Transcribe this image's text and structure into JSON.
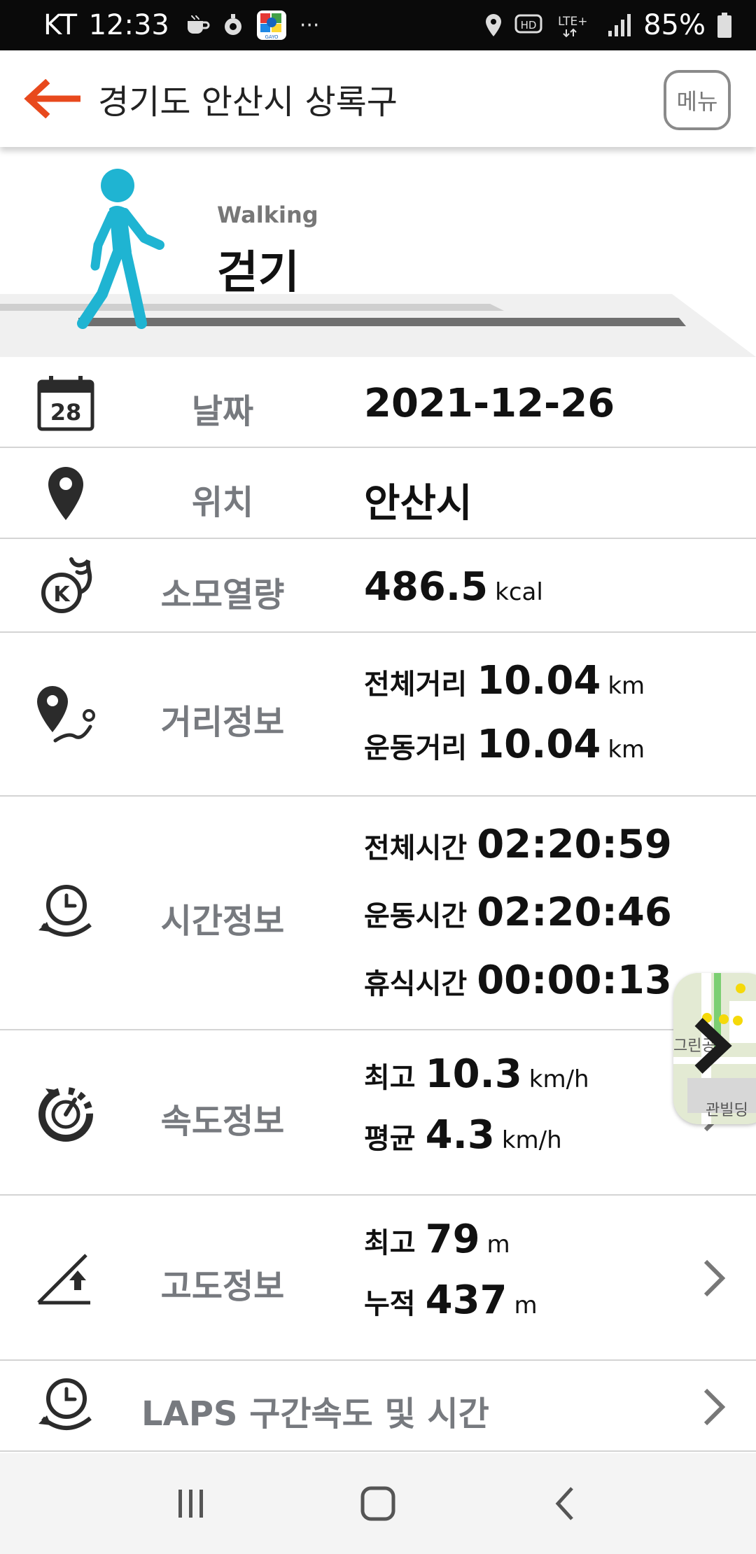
{
  "status_bar": {
    "carrier": "KT",
    "time": "12:33",
    "notification_icons": [
      "coffee-icon",
      "location-pin-icon",
      "gayo-app-icon",
      "more-icon"
    ],
    "lte_label": "LTE+",
    "hd_label": "HD",
    "battery_percent": "85%"
  },
  "header": {
    "title": "경기도 안산시 상록구",
    "menu_label": "메뉴",
    "accent_color": "#e8491d"
  },
  "activity": {
    "name_en": "Walking",
    "name_ko": "걷기",
    "figure_color": "#1fb4d2"
  },
  "rows": {
    "date": {
      "label": "날짜",
      "value": "2021-12-26",
      "calendar_day": "28"
    },
    "location": {
      "label": "위치",
      "value": "안산시"
    },
    "calories": {
      "label": "소모열량",
      "value": "486.5",
      "unit": "kcal"
    },
    "distance": {
      "label": "거리정보",
      "lines": [
        {
          "sub": "전체거리",
          "value": "10.04",
          "unit": "km"
        },
        {
          "sub": "운동거리",
          "value": "10.04",
          "unit": "km"
        }
      ]
    },
    "time": {
      "label": "시간정보",
      "lines": [
        {
          "sub": "전체시간",
          "value": "02:20:59"
        },
        {
          "sub": "운동시간",
          "value": "02:20:46"
        },
        {
          "sub": "휴식시간",
          "value": "00:00:13"
        }
      ]
    },
    "speed": {
      "label": "속도정보",
      "lines": [
        {
          "sub": "최고",
          "value": "10.3",
          "unit": "km/h"
        },
        {
          "sub": "평균",
          "value": "4.3",
          "unit": "km/h"
        }
      ]
    },
    "altitude": {
      "label": "고도정보",
      "lines": [
        {
          "sub": "최고",
          "value": "79",
          "unit": "m"
        },
        {
          "sub": "누적",
          "value": "437",
          "unit": "m"
        }
      ]
    },
    "laps": {
      "label": "LAPS 구간속도 및 시간"
    }
  },
  "map_thumb": {
    "text_top": "그린공",
    "text_bottom": "관빌딩"
  }
}
